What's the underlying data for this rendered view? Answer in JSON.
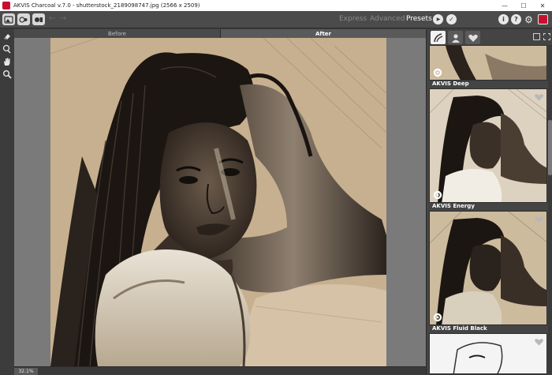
{
  "window": {
    "title": "AKVIS Charcoal v.7.0 - shutterstock_2189098747.jpg (2566 x 2509)",
    "controls": {
      "minimize": "—",
      "maximize": "☐",
      "close": "✕"
    }
  },
  "toolbar": {
    "modes": [
      "Express",
      "Advanced",
      "Presets"
    ],
    "active_mode": "Presets",
    "nav": {
      "back": "←",
      "forward": "→"
    },
    "run_symbol": "▶",
    "apply_symbol": "✓",
    "info_symbol": "i",
    "help_symbol": "?",
    "settings_symbol": "⚙"
  },
  "view_tabs": {
    "before": "Before",
    "after": "After"
  },
  "status": {
    "zoom": "32.1%"
  },
  "presets": [
    {
      "label": "AKVIS Deep"
    },
    {
      "label": "AKVIS Energy"
    },
    {
      "label": "AKVIS Fluid Black"
    }
  ],
  "colors": {
    "brand_red": "#c8102e",
    "sepia_bg": "#c7b08f",
    "panel_dark": "#444444"
  }
}
